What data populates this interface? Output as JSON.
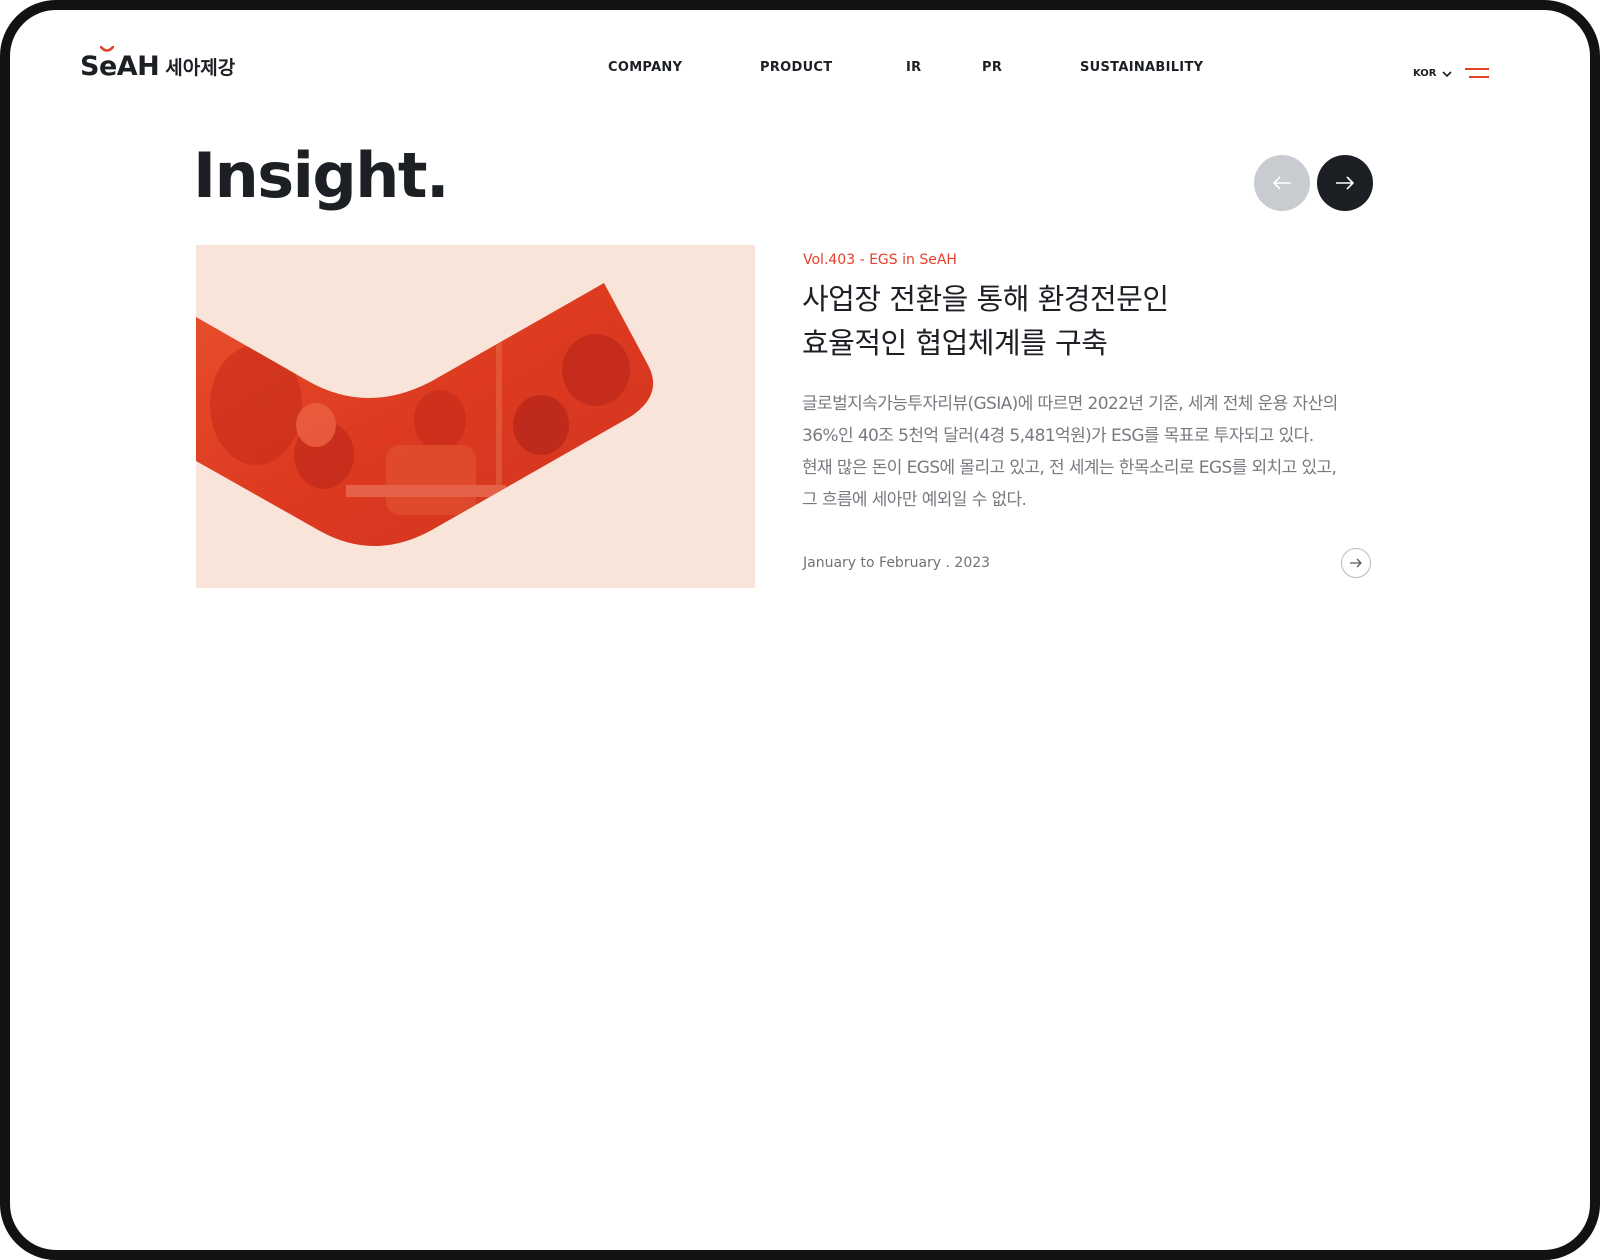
{
  "header": {
    "logo_en": "SeAH",
    "logo_kor": "세아제강",
    "nav": [
      "COMPANY",
      "PRODUCT",
      "IR",
      "PR",
      "SUSTAINABILITY"
    ],
    "lang": "KOR"
  },
  "section": {
    "title": "Insight."
  },
  "article": {
    "vol": "Vol.403 - EGS in SeAH",
    "headline": [
      "사업장 전환을 통해 환경전문인",
      "효율적인 협업체계를 구축"
    ],
    "description": [
      "글로벌지속가능투자리뷰(GSIA)에 따르면 2022년 기준, 세계 전체 운용 자산의",
      "36%인 40조 5천억 달러(4경 5,481억원)가 ESG를 목표로 투자되고 있다.",
      "현재 많은 돈이 EGS에 몰리고 있고, 전 세계는 한목소리로 EGS를 외치고 있고,",
      "그 흐름에 세아만 예외일 수 없다."
    ],
    "date": "January to February . 2023"
  },
  "colors": {
    "accent": "#e4402a",
    "dark": "#1c1f24",
    "thumb_bg": "#f9e4da",
    "prev_btn": "#c8cbcf"
  },
  "icons": {
    "menu": "hamburger-icon",
    "lang": "chevron-down-icon",
    "prev": "arrow-left-icon",
    "next": "arrow-right-icon",
    "more": "arrow-right-circle-icon"
  }
}
